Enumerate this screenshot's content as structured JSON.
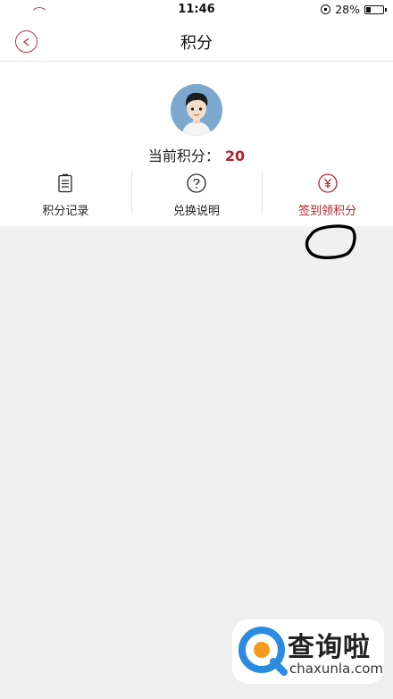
{
  "status_bar": {
    "time": "11:46",
    "battery": "28%",
    "battery_level": 0.28
  },
  "nav": {
    "title": "积分"
  },
  "profile": {
    "points_label": "当前积分：",
    "points_value": "20"
  },
  "actions": [
    {
      "label": "积分记录",
      "icon": "clipboard-icon"
    },
    {
      "label": "兑换说明",
      "icon": "question-circle-icon"
    },
    {
      "label": "签到领积分",
      "icon": "yen-circle-icon",
      "active": true
    }
  ],
  "colors": {
    "accent": "#b5232f",
    "background": "#f0f0f0"
  },
  "watermark": {
    "title": "查询啦",
    "subtitle": "chaxunla.com"
  }
}
